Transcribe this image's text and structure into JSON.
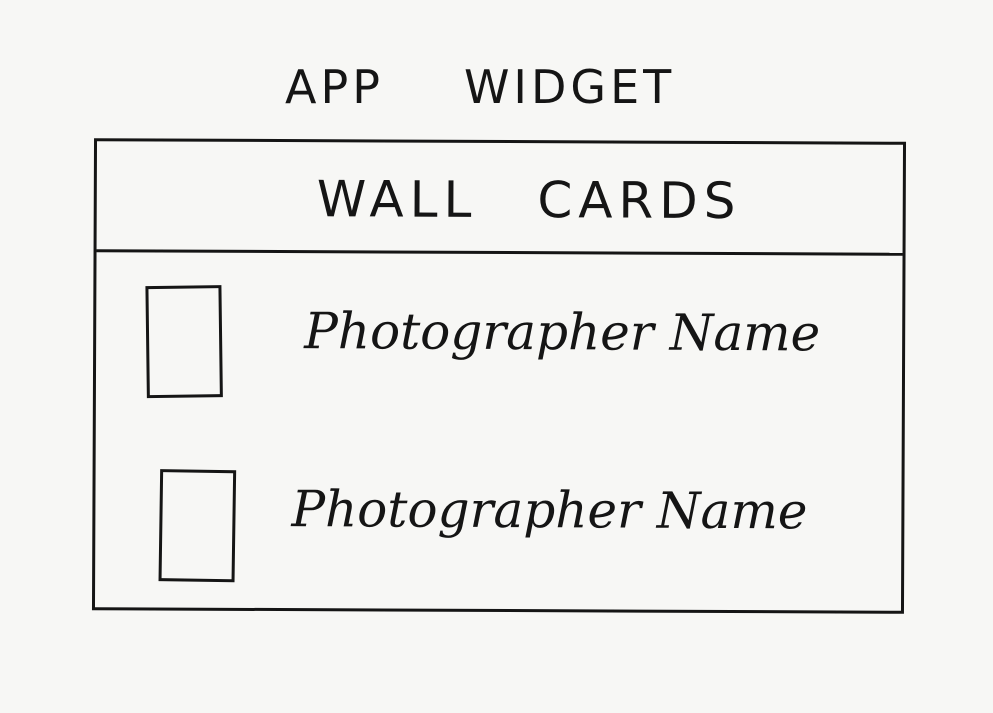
{
  "caption": {
    "word1": "APP",
    "word2": "WIDGET"
  },
  "widget": {
    "title_word1": "WALL",
    "title_word2": "CARDS",
    "items": [
      {
        "label": "Photographer Name"
      },
      {
        "label": "Photographer Name"
      }
    ]
  }
}
